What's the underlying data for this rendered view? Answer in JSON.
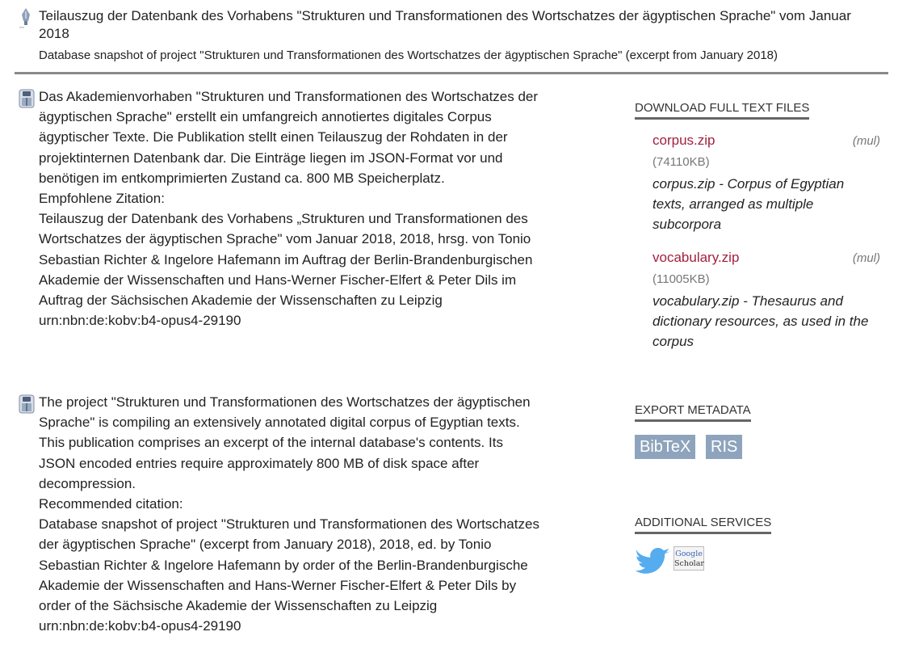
{
  "header": {
    "title": "Teilauszug der Datenbank des Vorhabens \"Strukturen und Transformationen des Wortschatzes der ägyptischen Sprache\" vom Januar 2018",
    "subtitle": "Database snapshot of project \"Strukturen und Transformationen des Wortschatzes der ägyptischen Sprache\" (excerpt from January 2018)"
  },
  "abstract_de": {
    "text": "Das Akademienvorhaben \"Strukturen und Transformationen des Wortschatzes der ägyptischen Sprache\" erstellt ein umfangreich annotiertes digitales Corpus ägyptischer Texte. Die Publikation stellt einen Teilauszug der Rohdaten in der projektinternen Datenbank dar. Die Einträge liegen im JSON-Format vor und benötigen im entkomprimierten Zustand ca. 800 MB Speicherplatz.",
    "citation_label": "Empfohlene Zitation:",
    "citation": "Teilauszug der Datenbank des Vorhabens „Strukturen und Transformationen des Wortschatzes der ägyptischen Sprache\" vom Januar 2018, 2018, hrsg. von Tonio Sebastian Richter & Ingelore Hafemann im Auftrag der Berlin-Brandenburgischen Akademie der Wissenschaften und Hans-Werner Fischer-Elfert & Peter Dils im Auftrag der Sächsischen Akademie der Wissenschaften zu Leipzig",
    "urn": "urn:nbn:de:kobv:b4-opus4-29190"
  },
  "abstract_en": {
    "text": "The project \"Strukturen und Transformationen des Wortschatzes der ägyptischen Sprache\" is compiling an extensively annotated digital corpus of Egyptian texts. This publication comprises an excerpt of the internal database's contents. Its JSON encoded entries require approximately 800 MB of disk space after decompression.",
    "citation_label": "Recommended citation:",
    "citation": "Database snapshot of project \"Strukturen und Transformationen des Wortschatzes der ägyptischen Sprache\" (excerpt from January 2018), 2018, ed. by Tonio Sebastian Richter & Ingelore Hafemann by order of the Berlin-Brandenburgische Akademie der Wissenschaften and Hans-Werner Fischer-Elfert & Peter Dils by order of the Sächsische Akademie der Wissenschaften zu Leipzig",
    "urn": "urn:nbn:de:kobv:b4-opus4-29190"
  },
  "sidebar": {
    "download_heading": "DOWNLOAD FULL TEXT FILES",
    "files": [
      {
        "name": "corpus.zip",
        "lang": "(mul)",
        "size": "(74110KB)",
        "description": "corpus.zip - Corpus of Egyptian texts, arranged as multiple subcorpora"
      },
      {
        "name": "vocabulary.zip",
        "lang": "(mul)",
        "size": "(11005KB)",
        "description": "vocabulary.zip - Thesaurus and dictionary resources, as used in the corpus"
      }
    ],
    "export_heading": "EXPORT METADATA",
    "export_buttons": [
      "BibTeX",
      "RIS"
    ],
    "services_heading": "ADDITIONAL SERVICES",
    "google_scholar_lines": [
      "Google",
      "Scholar"
    ]
  },
  "colors": {
    "link": "#a3213e",
    "button_bg": "#8ea4bc",
    "rule": "#8a8a8a"
  },
  "icons": [
    "fountain-pen-icon",
    "german-flag-icon",
    "english-flag-icon",
    "twitter-icon",
    "google-scholar-icon"
  ]
}
